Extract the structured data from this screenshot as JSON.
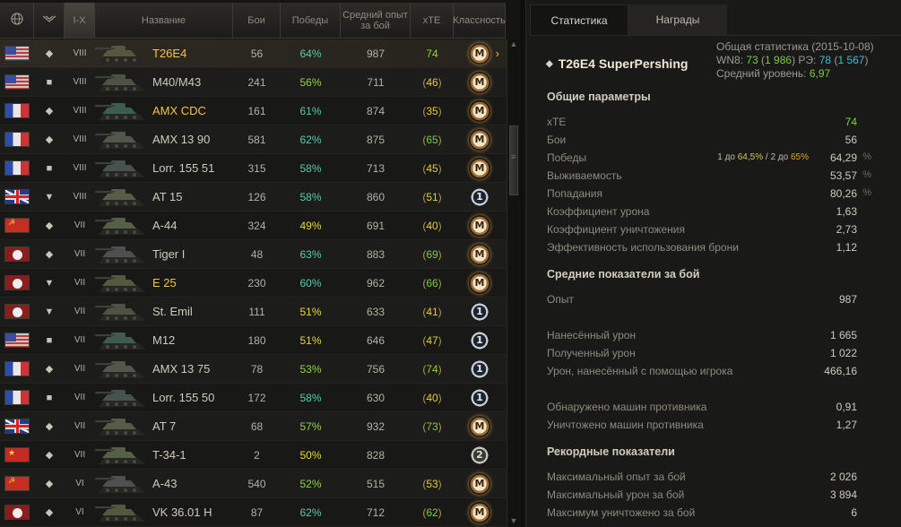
{
  "table": {
    "headers": {
      "nation_icon": "globe-icon",
      "type_icon": "vehicle-type-icon",
      "tier": "I-X",
      "name": "Название",
      "battles": "Бои",
      "wins": "Победы",
      "avg_xp": "Средний опыт за бой",
      "xte": "xTE",
      "class": "Классность"
    },
    "rows": [
      {
        "nation": "usa",
        "type": "heavy",
        "tier": "VIII",
        "name": "T26E4",
        "gold": true,
        "battles": "56",
        "wins": "64%",
        "wcol": "g",
        "xp": "987",
        "xte": "74",
        "xcol": "green",
        "br": false,
        "badge": "M",
        "selected": true
      },
      {
        "nation": "usa",
        "type": "spg",
        "tier": "VIII",
        "name": "M40/M43",
        "gold": false,
        "battles": "241",
        "wins": "56%",
        "wcol": "lg",
        "xp": "711",
        "xte": "46",
        "xcol": "yellow",
        "br": true,
        "badge": "M"
      },
      {
        "nation": "france",
        "type": "heavy",
        "tier": "VIII",
        "name": "AMX CDC",
        "gold": true,
        "battles": "161",
        "wins": "61%",
        "wcol": "g",
        "xp": "874",
        "xte": "35",
        "xcol": "yellow",
        "br": true,
        "badge": "M"
      },
      {
        "nation": "france",
        "type": "light",
        "tier": "VIII",
        "name": "AMX 13 90",
        "gold": false,
        "battles": "581",
        "wins": "62%",
        "wcol": "g",
        "xp": "875",
        "xte": "65",
        "xcol": "lgreen",
        "br": true,
        "badge": "M"
      },
      {
        "nation": "france",
        "type": "spg",
        "tier": "VIII",
        "name": "Lorr. 155 51",
        "gold": false,
        "battles": "315",
        "wins": "58%",
        "wcol": "g",
        "xp": "713",
        "xte": "45",
        "xcol": "yellow",
        "br": true,
        "badge": "M"
      },
      {
        "nation": "uk",
        "type": "td",
        "tier": "VIII",
        "name": "AT 15",
        "gold": false,
        "battles": "126",
        "wins": "58%",
        "wcol": "g",
        "xp": "860",
        "xte": "51",
        "xcol": "yellow",
        "br": true,
        "badge": "1"
      },
      {
        "nation": "ussr",
        "type": "medium",
        "tier": "VII",
        "name": "A-44",
        "gold": false,
        "battles": "324",
        "wins": "49%",
        "wcol": "y",
        "xp": "691",
        "xte": "40",
        "xcol": "yellow",
        "br": true,
        "badge": "M"
      },
      {
        "nation": "germany",
        "type": "heavy",
        "tier": "VII",
        "name": "Tiger I",
        "gold": false,
        "battles": "48",
        "wins": "63%",
        "wcol": "g",
        "xp": "883",
        "xte": "69",
        "xcol": "lgreen",
        "br": true,
        "badge": "M"
      },
      {
        "nation": "germany",
        "type": "td",
        "tier": "VII",
        "name": "E 25",
        "gold": true,
        "battles": "230",
        "wins": "60%",
        "wcol": "g",
        "xp": "962",
        "xte": "66",
        "xcol": "lgreen",
        "br": true,
        "badge": "M"
      },
      {
        "nation": "germany",
        "type": "td",
        "tier": "VII",
        "name": "St. Emil",
        "gold": false,
        "battles": "111",
        "wins": "51%",
        "wcol": "y",
        "xp": "633",
        "xte": "41",
        "xcol": "yellow",
        "br": true,
        "badge": "1"
      },
      {
        "nation": "usa",
        "type": "spg",
        "tier": "VII",
        "name": "M12",
        "gold": false,
        "battles": "180",
        "wins": "51%",
        "wcol": "y",
        "xp": "646",
        "xte": "47",
        "xcol": "yellow",
        "br": true,
        "badge": "1"
      },
      {
        "nation": "france",
        "type": "light",
        "tier": "VII",
        "name": "AMX 13 75",
        "gold": false,
        "battles": "78",
        "wins": "53%",
        "wcol": "lg",
        "xp": "756",
        "xte": "74",
        "xcol": "green",
        "br": true,
        "badge": "1"
      },
      {
        "nation": "france",
        "type": "spg",
        "tier": "VII",
        "name": "Lorr. 155 50",
        "gold": false,
        "battles": "172",
        "wins": "58%",
        "wcol": "g",
        "xp": "630",
        "xte": "40",
        "xcol": "yellow",
        "br": true,
        "badge": "1"
      },
      {
        "nation": "uk",
        "type": "medium",
        "tier": "VII",
        "name": "AT 7",
        "gold": false,
        "battles": "68",
        "wins": "57%",
        "wcol": "lg",
        "xp": "932",
        "xte": "73",
        "xcol": "lgreen",
        "br": true,
        "badge": "M"
      },
      {
        "nation": "china",
        "type": "light",
        "tier": "VII",
        "name": "T-34-1",
        "gold": false,
        "battles": "2",
        "wins": "50%",
        "wcol": "y",
        "xp": "828",
        "xte": "",
        "xcol": "",
        "br": false,
        "badge": "2"
      },
      {
        "nation": "ussr",
        "type": "medium",
        "tier": "VI",
        "name": "A-43",
        "gold": false,
        "battles": "540",
        "wins": "52%",
        "wcol": "lg",
        "xp": "515",
        "xte": "53",
        "xcol": "yellow",
        "br": true,
        "badge": "M"
      },
      {
        "nation": "germany",
        "type": "heavy",
        "tier": "VI",
        "name": "VK 36.01 H",
        "gold": false,
        "battles": "87",
        "wins": "62%",
        "wcol": "g",
        "xp": "712",
        "xte": "62",
        "xcol": "lgreen",
        "br": true,
        "badge": "M"
      }
    ]
  },
  "panel": {
    "tabs": [
      "Статистика",
      "Награды"
    ],
    "vehicle_name": "T26E4 SuperPershing",
    "summary": {
      "line1": "Общая статистика (2015-10-08)",
      "wn8_label": "WN8:",
      "wn8": "73",
      "wn8_detail": "1 986",
      "re_label": "РЭ:",
      "re": "78",
      "re_detail": "1 567",
      "avg_level_label": "Средний уровень:",
      "avg_level": "6,97"
    },
    "sections": [
      {
        "title": "Общие параметры",
        "rows": [
          {
            "label": "xTE",
            "value": "74",
            "green": true
          },
          {
            "label": "Бои",
            "value": "56"
          },
          {
            "label": "Победы",
            "value": "64,29",
            "pct": "%",
            "extra": true
          },
          {
            "label": "Выживаемость",
            "value": "53,57",
            "pct": "%"
          },
          {
            "label": "Попадания",
            "value": "80,26",
            "pct": "%"
          },
          {
            "label": "Коэффициент урона",
            "value": "1,63"
          },
          {
            "label": "Коэффициент уничтожения",
            "value": "2,73"
          },
          {
            "label": "Эффективность использования брони",
            "value": "1,12"
          }
        ]
      },
      {
        "title": "Средние показатели за бой",
        "rows": [
          {
            "label": "Опыт",
            "value": "987"
          },
          {
            "label": "Нанесённый урон",
            "value": "1 665"
          },
          {
            "label": "Полученный урон",
            "value": "1 022"
          },
          {
            "label": "Урон, нанесённый с помощью игрока",
            "value": "466,16"
          },
          {
            "label": "Обнаружено машин противника",
            "value": "0,91"
          },
          {
            "label": "Уничтожено машин противника",
            "value": "1,27"
          }
        ]
      },
      {
        "title": "Рекордные показатели",
        "rows": [
          {
            "label": "Максимальный опыт за бой",
            "value": "2 026"
          },
          {
            "label": "Максимальный урон за бой",
            "value": "3 894"
          },
          {
            "label": "Максимум уничтожено за бой",
            "value": "6"
          }
        ]
      }
    ],
    "wins_extra": {
      "a": "1",
      "a_to": "до",
      "a_val": "64,5%",
      "sep": "/",
      "b": "2",
      "b_to": "до",
      "b_val": "65%"
    }
  },
  "colors": {
    "accent_gold": "#f6c34b",
    "green": "#7bd240",
    "cyan": "#42bbd0",
    "yellow": "#e6cf38"
  }
}
